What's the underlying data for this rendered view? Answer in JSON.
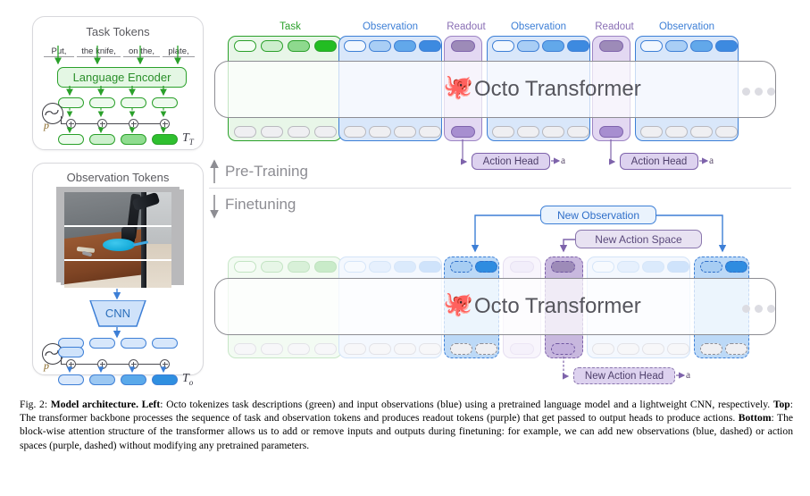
{
  "figure": {
    "number": "Fig. 2:",
    "caption_parts": [
      {
        "t": "Fig. 2: ",
        "b": false
      },
      {
        "t": "Model architecture. Left",
        "b": true
      },
      {
        "t": ": Octo tokenizes task descriptions (green) and input observations (blue) using a pretrained language model and a lightweight CNN, respectively. ",
        "b": false
      },
      {
        "t": "Top",
        "b": true
      },
      {
        "t": ": The transformer backbone processes the sequence of task and observation tokens and produces readout tokens (purple) that get passed to output heads to produce actions. ",
        "b": false
      },
      {
        "t": "Bottom",
        "b": true
      },
      {
        "t": ": The block-wise attention structure of the transformer allows us to add or remove inputs and outputs during finetuning: for example, we can add new observations (blue, dashed) or action spaces (purple, dashed) without modifying any pretrained parameters.",
        "b": false
      }
    ]
  },
  "task_panel": {
    "title": "Task Tokens",
    "words": [
      "Put,",
      "the knife,",
      "on the,",
      "plate,"
    ],
    "encoder_label": "Language Encoder",
    "positional_label": "p",
    "output_label": "T",
    "output_sub": "T"
  },
  "observation_panel": {
    "title": "Observation Tokens",
    "encoder_label": "CNN",
    "positional_label": "p",
    "output_label": "T",
    "output_sub": "o"
  },
  "transformer": {
    "title": "Octo Transformer",
    "octopus_icon": "octopus-icon",
    "ellipsis_icon": "ellipsis-icon"
  },
  "top_section": {
    "column_labels": [
      {
        "text": "Task",
        "color": "#2aa02a"
      },
      {
        "text": "Observation",
        "color": "#3d7fd6"
      },
      {
        "text": "Readout",
        "color": "#8a6fb5"
      },
      {
        "text": "Observation",
        "color": "#3d7fd6"
      },
      {
        "text": "Readout",
        "color": "#8a6fb5"
      },
      {
        "text": "Observation",
        "color": "#3d7fd6"
      }
    ],
    "heads": [
      {
        "label": "Action Head",
        "action": "a"
      },
      {
        "label": "Action Head",
        "action": "a"
      }
    ]
  },
  "phases": [
    {
      "label": "Pre-Training",
      "arrow": "up-arrow-icon"
    },
    {
      "label": "Finetuning",
      "arrow": "down-arrow-icon"
    }
  ],
  "bottom_section": {
    "annotations": [
      {
        "label": "New Observation",
        "color": "#3d7fd6"
      },
      {
        "label": "New Action Space",
        "color": "#6f5a93"
      }
    ],
    "head": {
      "label": "New Action Head",
      "action": "a"
    }
  },
  "colors": {
    "green": "#2aa02a",
    "blue": "#3d7fd6",
    "purple": "#8a6fb5",
    "grey": "#8d8d93"
  }
}
